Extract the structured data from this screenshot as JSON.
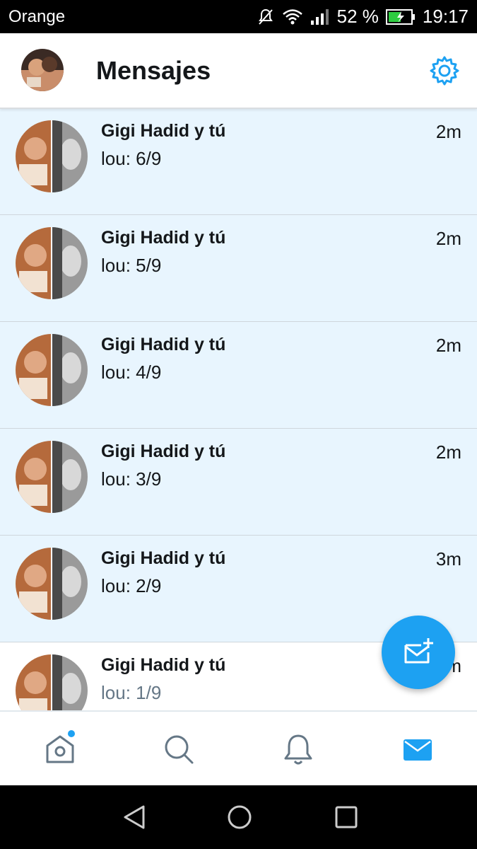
{
  "status_bar": {
    "carrier": "Orange",
    "battery_percent": "52 %",
    "time": "19:17"
  },
  "header": {
    "title": "Mensajes"
  },
  "conversations": [
    {
      "name": "Gigi Hadid y tú",
      "preview": "lou: 6/9",
      "time": "2m",
      "unread": true
    },
    {
      "name": "Gigi Hadid y tú",
      "preview": "lou: 5/9",
      "time": "2m",
      "unread": true
    },
    {
      "name": "Gigi Hadid y tú",
      "preview": "lou: 4/9",
      "time": "2m",
      "unread": true
    },
    {
      "name": "Gigi Hadid y tú",
      "preview": "lou: 3/9",
      "time": "2m",
      "unread": true
    },
    {
      "name": "Gigi Hadid y tú",
      "preview": "lou: 2/9",
      "time": "3m",
      "unread": true
    },
    {
      "name": "Gigi Hadid y tú",
      "preview": "lou: 1/9",
      "time": "3m",
      "unread": false
    }
  ],
  "bottom_nav": {
    "items": [
      "home-icon",
      "search-icon",
      "bell-icon",
      "mail-icon"
    ],
    "active": "mail-icon"
  },
  "colors": {
    "accent": "#1da1f2",
    "unread_bg": "#e8f5fe",
    "text": "#14171a",
    "muted": "#657786"
  }
}
